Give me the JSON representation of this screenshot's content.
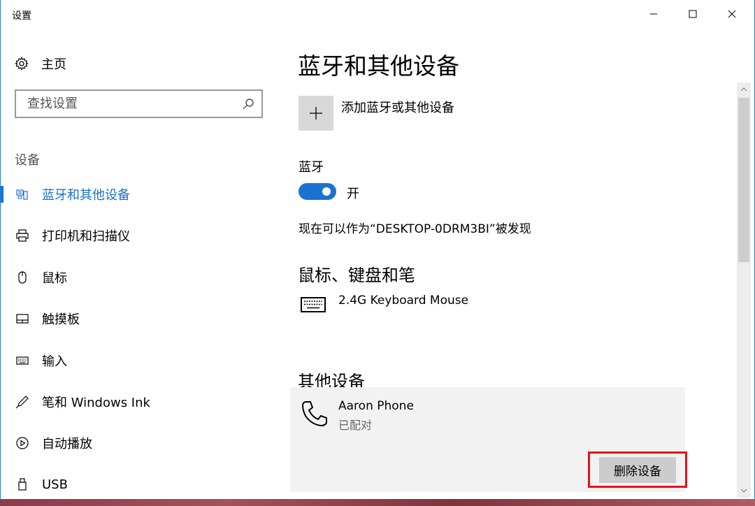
{
  "window": {
    "title": "设置",
    "minimize": "—",
    "maximize": "☐",
    "close": "✕"
  },
  "sidebar": {
    "home_label": "主页",
    "search_placeholder": "查找设置",
    "section_label": "设备",
    "items": [
      {
        "label": "蓝牙和其他设备",
        "icon": "bluetooth-devices-icon",
        "active": true
      },
      {
        "label": "打印机和扫描仪",
        "icon": "printer-icon",
        "active": false
      },
      {
        "label": "鼠标",
        "icon": "mouse-icon",
        "active": false
      },
      {
        "label": "触摸板",
        "icon": "touchpad-icon",
        "active": false
      },
      {
        "label": "输入",
        "icon": "keyboard-icon",
        "active": false
      },
      {
        "label": "笔和 Windows Ink",
        "icon": "pen-icon",
        "active": false
      },
      {
        "label": "自动播放",
        "icon": "autoplay-icon",
        "active": false
      },
      {
        "label": "USB",
        "icon": "usb-icon",
        "active": false
      }
    ]
  },
  "main": {
    "title": "蓝牙和其他设备",
    "add_device_label": "添加蓝牙或其他设备",
    "bluetooth_label": "蓝牙",
    "bluetooth_state": "开",
    "discoverable_text": "现在可以作为“DESKTOP-0DRM3BI”被发现",
    "mouse_section_title": "鼠标、键盘和笔",
    "mouse_devices": [
      {
        "name": "2.4G Keyboard Mouse",
        "icon": "keyboard-icon"
      }
    ],
    "other_section_title": "其他设备",
    "other_devices": [
      {
        "name": "Aaron Phone",
        "status": "已配对",
        "icon": "phone-icon"
      }
    ],
    "remove_button_label": "删除设备"
  },
  "colors": {
    "accent": "#1a73d0",
    "highlight": "#e1141a"
  }
}
